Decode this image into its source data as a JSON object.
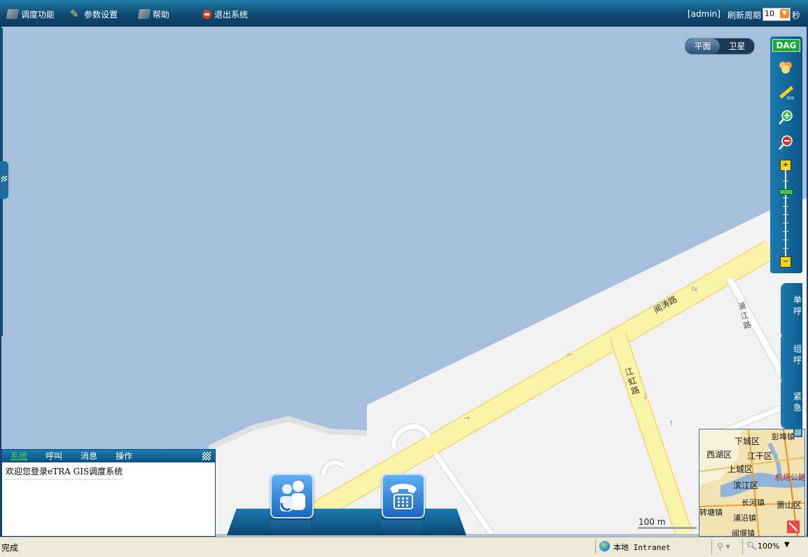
{
  "menu": {
    "dispatch": "调度功能",
    "params": "参数设置",
    "help": "帮助",
    "exit": "退出系统"
  },
  "header": {
    "user": "[admin]",
    "refresh_label": "刷新周期",
    "refresh_value": "10",
    "refresh_unit": "秒"
  },
  "map_type": {
    "options": [
      "平面",
      "卫星"
    ],
    "selected": "平面"
  },
  "toolbar": {
    "badge": "DAG"
  },
  "map_labels": {
    "road1": "闻涛路",
    "road2": "江虹路",
    "road3": "浦江路"
  },
  "side_tabs": {
    "single_call": "单呼",
    "group_call": "组呼",
    "emergency": "紧急"
  },
  "minimap": {
    "labels": [
      "下城区",
      "彭埠镇",
      "西湖区",
      "江干区",
      "上城区",
      "机场公路",
      "滨江区",
      "长河镇",
      "萧山区",
      "浦沿镇",
      "转塘镇",
      "闻堰镇"
    ]
  },
  "scale": "100 m",
  "panel": {
    "tabs": [
      "系统",
      "呼叫",
      "消息",
      "操作"
    ],
    "active_tab": "系统",
    "message": "欢迎您登录eTRA GIS调度系统"
  },
  "statusbar": {
    "done": "完成",
    "zone": "本地 Intranet",
    "zoom": "100%"
  },
  "colors": {
    "water": "#a5bfdd",
    "land": "#f2f2f2",
    "road": "#fbf3a6",
    "chrome": "#0e4a72"
  }
}
